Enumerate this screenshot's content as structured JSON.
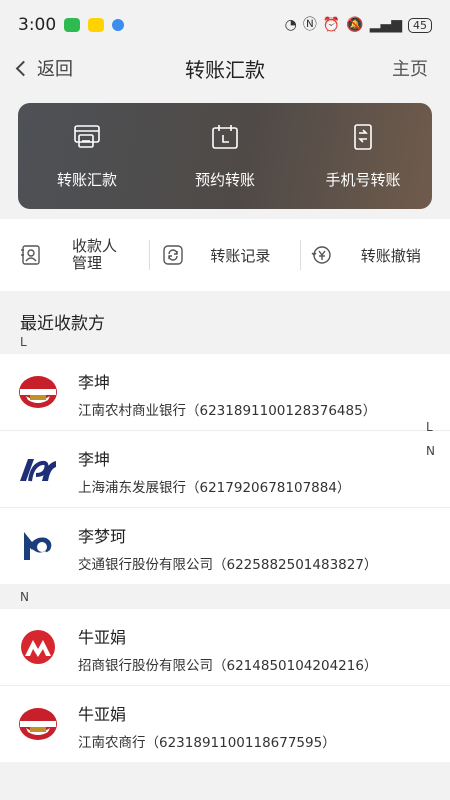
{
  "status_bar": {
    "time": "3:00",
    "battery": "45"
  },
  "nav": {
    "back_label": "返回",
    "title": "转账汇款",
    "home_label": "主页"
  },
  "hero_actions": [
    {
      "label": "转账汇款",
      "icon": "card-transfer-icon"
    },
    {
      "label": "预约转账",
      "icon": "calendar-icon"
    },
    {
      "label": "手机号转账",
      "icon": "phone-transfer-icon"
    }
  ],
  "quick_actions": [
    {
      "label_line1": "收款人",
      "label_line2": "管理",
      "icon": "payee-card-icon"
    },
    {
      "label": "转账记录",
      "icon": "refresh-record-icon"
    },
    {
      "label": "转账撤销",
      "icon": "yuan-revoke-icon"
    }
  ],
  "recent": {
    "title": "最近收款方",
    "groups": [
      {
        "letter": "L",
        "payees": [
          {
            "name": "李坤",
            "detail": "江南农村商业银行（6231891100128376485）",
            "logo": "jiangnan-bank-logo"
          },
          {
            "name": "李坤",
            "detail": "上海浦东发展银行（6217920678107884）",
            "logo": "spdb-logo"
          },
          {
            "name": "李梦珂",
            "detail": "交通银行股份有限公司（6225882501483827）",
            "logo": "bocom-logo"
          }
        ]
      },
      {
        "letter": "N",
        "payees": [
          {
            "name": "牛亚娟",
            "detail": "招商银行股份有限公司（6214850104204216）",
            "logo": "cmb-logo"
          },
          {
            "name": "牛亚娟",
            "detail": "江南农商行（6231891100118677595）",
            "logo": "jiangnan-bank-logo"
          }
        ]
      }
    ]
  },
  "index_letters": [
    "L",
    "N"
  ],
  "colors": {
    "hero_start": "#4e5156",
    "hero_end": "#6f5b4c",
    "jiangnan_red": "#c8202a",
    "spdb_navy": "#1e2f77",
    "bocom_blue": "#1a3d7c",
    "cmb_red": "#d7262e"
  }
}
